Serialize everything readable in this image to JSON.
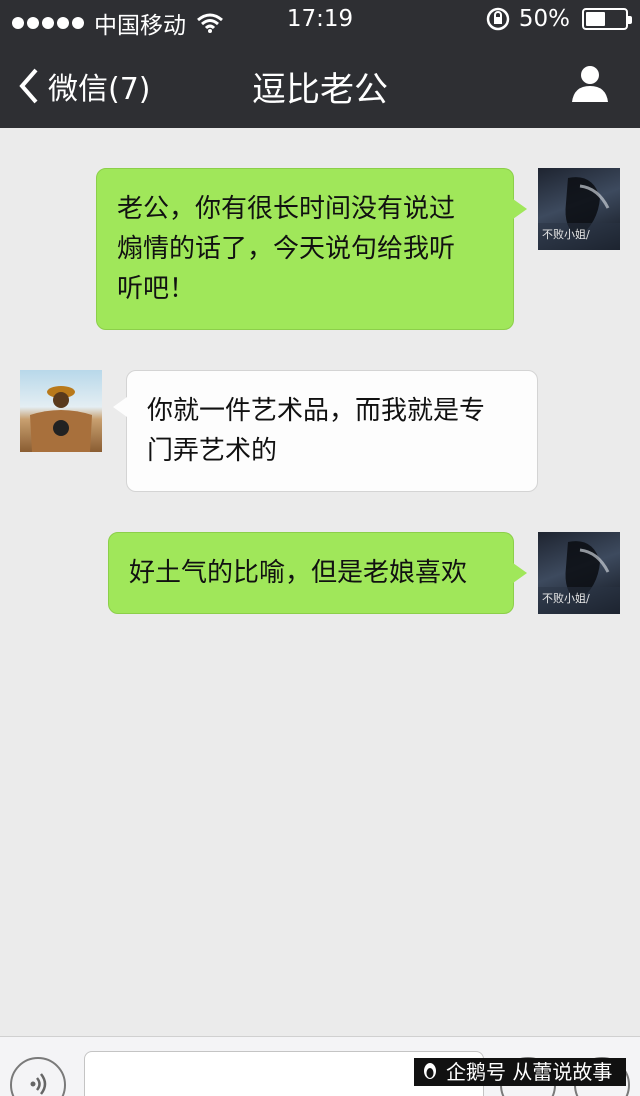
{
  "status_bar": {
    "carrier": "中国移动",
    "time": "17:19",
    "battery": "50%",
    "battery_level": 0.5,
    "signal_dots": 5
  },
  "nav": {
    "back_label": "微信(7)",
    "title": "逗比老公"
  },
  "messages": [
    {
      "side": "right",
      "avatar_caption": "不败小姐/",
      "text_lines": [
        "老公，你有很长时间没有说过",
        "煽情的话了，今天说句给我听",
        "听吧！"
      ]
    },
    {
      "side": "left",
      "text_lines": [
        "你就一件艺术品，而我就是专",
        "门弄艺术的"
      ]
    },
    {
      "side": "right",
      "avatar_caption": "不败小姐/",
      "text_lines": [
        "好土气的比喻，但是老娘喜欢"
      ]
    }
  ],
  "watermark": {
    "text": "企鹅号 从蕾说故事"
  },
  "colors": {
    "topbar": "#2e2f33",
    "chat_bg": "#ebebeb",
    "bubble_green": "#a0e75a",
    "bubble_white": "#fdfdfd"
  },
  "icons": [
    "wifi-icon",
    "rotation-lock-icon",
    "battery-icon",
    "back-chevron-icon",
    "profile-icon",
    "voice-icon",
    "emoji-icon",
    "plus-icon",
    "penguin-icon"
  ]
}
